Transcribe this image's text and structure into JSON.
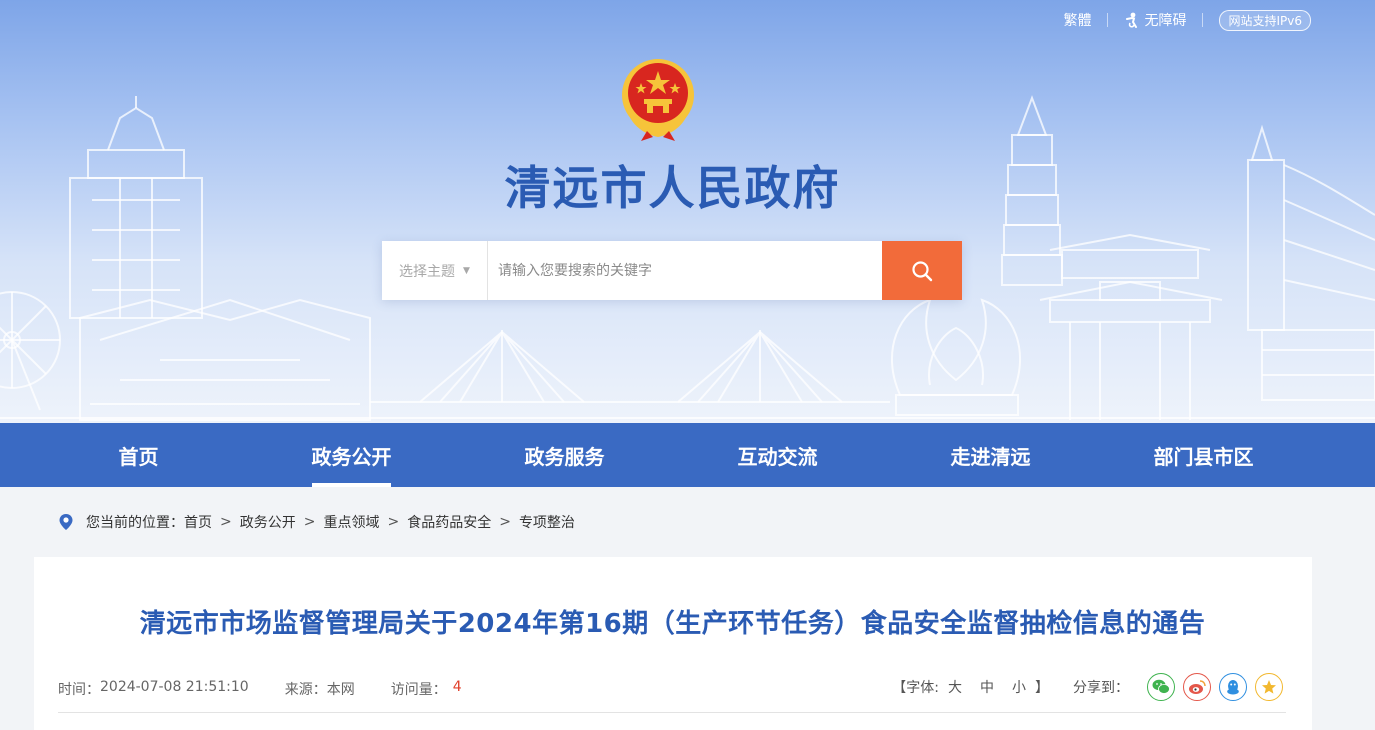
{
  "header": {
    "top_links": {
      "traditional": "繁體",
      "accessibility": "无障碍",
      "ipv6": "网站支持IPv6"
    },
    "site_title": "清远市人民政府",
    "search": {
      "topic_label": "选择主题",
      "placeholder": "请输入您要搜索的关键字"
    }
  },
  "nav": {
    "items": [
      {
        "label": "首页"
      },
      {
        "label": "政务公开"
      },
      {
        "label": "政务服务"
      },
      {
        "label": "互动交流"
      },
      {
        "label": "走进清远"
      },
      {
        "label": "部门县市区"
      }
    ],
    "active_index": 1
  },
  "breadcrumb": {
    "prefix": "您当前的位置：",
    "items": [
      "首页",
      "政务公开",
      "重点领域",
      "食品药品安全",
      "专项整治"
    ],
    "separator": ">"
  },
  "article": {
    "title": "清远市市场监督管理局关于2024年第16期（生产环节任务）食品安全监督抽检信息的通告",
    "time_label": "时间：",
    "time": "2024-07-08 21:51:10",
    "source_label": "来源：",
    "source": "本网",
    "views_label": "访问量：",
    "views": "4",
    "font_size_prefix": "【字体:",
    "font_size_large": "大",
    "font_size_medium": "中",
    "font_size_small": "小",
    "font_size_suffix": "】",
    "share_label": "分享到："
  },
  "colors": {
    "brand_blue": "#3a6ac3",
    "title_blue": "#2a5bb3",
    "search_orange": "#f26b3a",
    "views_red": "#e0402a",
    "wechat_green": "#3fb34f",
    "weibo_red": "#e4574a",
    "qq_blue": "#2f8fe0",
    "qzone_yellow": "#f2b82f"
  },
  "icons": {
    "emblem": "national-emblem-icon",
    "accessibility": "person-icon",
    "search": "search-icon",
    "location": "location-pin-icon",
    "shares": [
      "wechat-icon",
      "weibo-icon",
      "qq-icon",
      "qzone-icon"
    ]
  }
}
